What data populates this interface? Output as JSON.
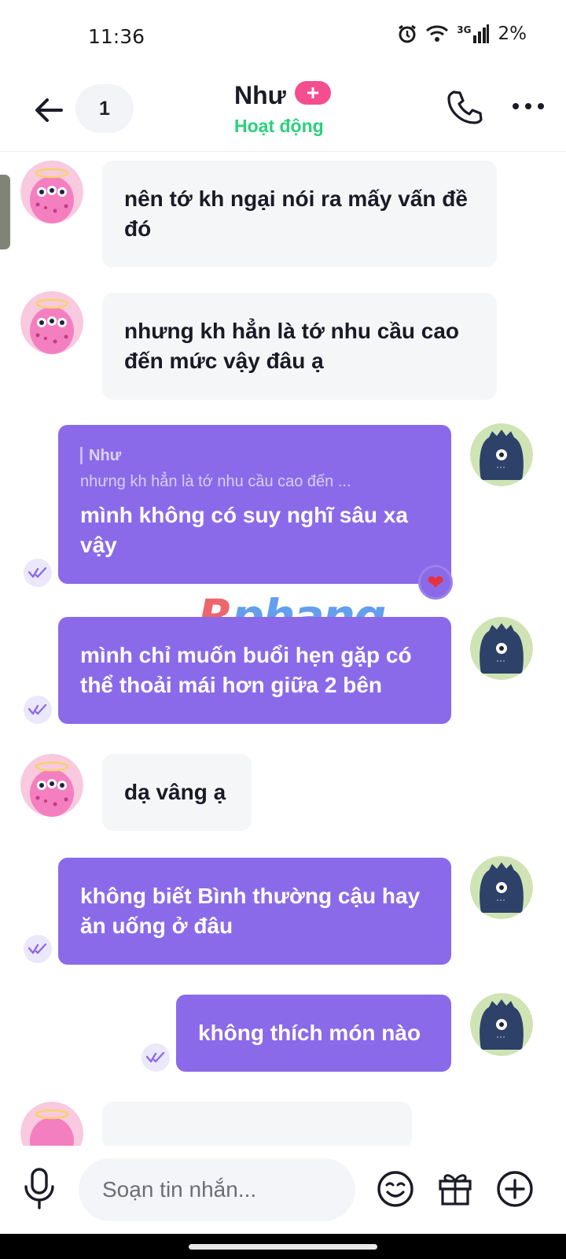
{
  "status_bar": {
    "time": "11:36",
    "network": "3G",
    "battery": "2%",
    "icons": [
      "alarm-icon",
      "wifi-icon",
      "signal-icon"
    ]
  },
  "header": {
    "unread_count": "1",
    "contact_name": "Như",
    "plus_label": "+",
    "contact_status": "Hoạt động",
    "status_color": "#29d07a",
    "badge_color": "#f44e8e"
  },
  "watermark": {
    "text_a": "R",
    "text_b": "phang"
  },
  "messages": [
    {
      "dir": "in",
      "text": "nên tớ kh ngại nói ra mấy vấn đề đó"
    },
    {
      "dir": "in",
      "text": "nhưng kh hẳn là tớ nhu cầu cao đến mức vậy đâu ạ"
    },
    {
      "dir": "out",
      "reply_to_name": "Như",
      "reply_to_text": "nhưng kh hẳn là tớ nhu cầu cao đến ...",
      "text": "mình không có suy nghĩ sâu xa vậy",
      "reaction": "❤"
    },
    {
      "dir": "out",
      "text": "mình chỉ muốn buổi hẹn gặp có thể thoải mái hơn giữa 2 bên"
    },
    {
      "dir": "in",
      "text": "dạ vâng ạ"
    },
    {
      "dir": "out",
      "text": "không biết Bình thường cậu hay ăn uống ở đâu"
    },
    {
      "dir": "out",
      "text": "không thích món nào"
    }
  ],
  "composer": {
    "placeholder": "Soạn tin nhắn...",
    "icons": [
      "microphone-icon",
      "emoji-icon",
      "gift-icon",
      "plus-circle-icon"
    ]
  },
  "colors": {
    "outgoing_bubble": "#8b6ae9",
    "incoming_bubble": "#f5f6f8",
    "seen_icon": "#8b6ae9"
  }
}
